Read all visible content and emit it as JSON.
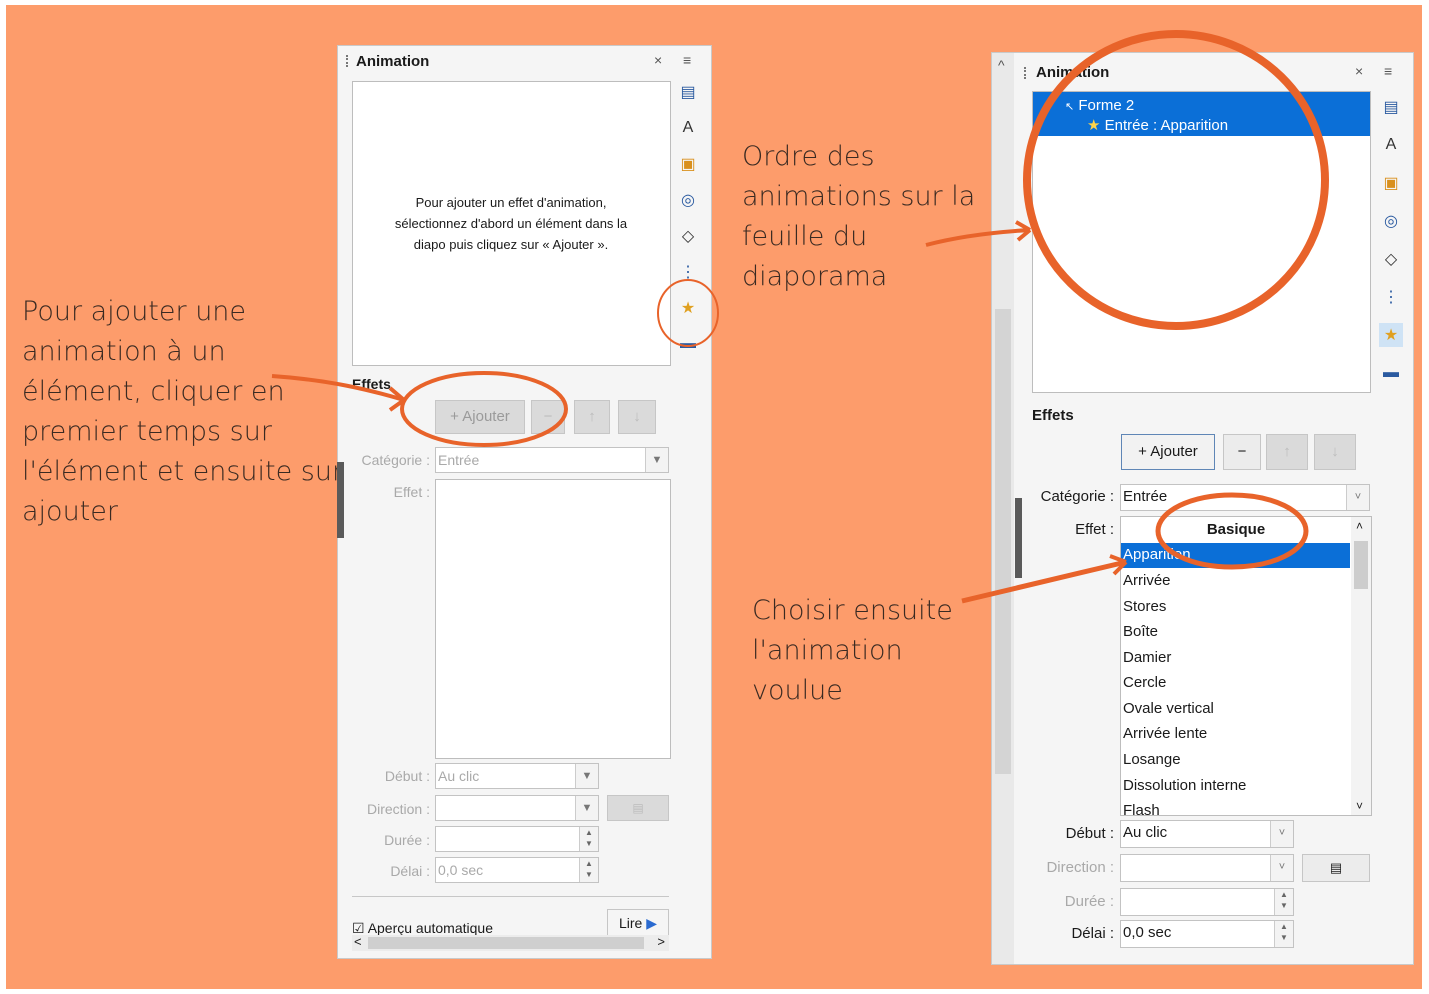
{
  "colors": {
    "background": "#fd9c6b",
    "annotation": "#e8632a",
    "selection": "#0b6fd7"
  },
  "notes": {
    "left": "Pour ajouter une\nanimation à un\nélément, cliquer en\npremier temps sur\nl'élément et ensuite sur\najouter",
    "order": "Ordre des\nanimations sur la\nfeuille du\ndiaporama",
    "choose": "Choisir ensuite\nl'animation\nvoulue"
  },
  "left_panel": {
    "title": "Animation",
    "close": "×",
    "menu": "≡",
    "hint": "Pour ajouter un effet d'animation,\nsélectionnez d'abord un élément dans la\ndiapo puis cliquez sur « Ajouter ».",
    "effects_heading": "Effets",
    "add_label": "+ Ajouter",
    "remove_label": "−",
    "up_label": "↑",
    "down_label": "↓",
    "category_label": "Catégorie :",
    "category_value": "Entrée",
    "effect_label": "Effet :",
    "start_label": "Début :",
    "start_value": "Au clic",
    "direction_label": "Direction :",
    "duration_label": "Durée :",
    "delay_label": "Délai :",
    "delay_value": "0,0 sec",
    "autopreview_label": "Aperçu automatique",
    "play_label": "Lire",
    "scroll_left": "<",
    "scroll_right": ">"
  },
  "right_panel": {
    "title": "Animation",
    "close": "×",
    "menu": "≡",
    "collapse": "^",
    "anim_list": [
      {
        "label": "Forme 2"
      },
      {
        "label": "Entrée : Apparition"
      }
    ],
    "effects_heading": "Effets",
    "add_label": "+ Ajouter",
    "remove_label": "−",
    "up_label": "↑",
    "down_label": "↓",
    "category_label": "Catégorie :",
    "category_value": "Entrée",
    "effect_label": "Effet :",
    "group_header": "Basique",
    "effect_items": [
      "Apparition",
      "Arrivée",
      "Stores",
      "Boîte",
      "Damier",
      "Cercle",
      "Ovale vertical",
      "Arrivée lente",
      "Losange",
      "Dissolution interne",
      "Flash"
    ],
    "start_label": "Début :",
    "start_value": "Au clic",
    "direction_label": "Direction :",
    "duration_label": "Durée :",
    "delay_label": "Délai :",
    "delay_value": "0,0 sec"
  },
  "sidebar_icons": [
    "properties-icon",
    "styles-icon",
    "gallery-icon",
    "navigator-icon",
    "shapes-icon",
    "slide-transition-icon",
    "animation-icon",
    "master-slides-icon"
  ]
}
